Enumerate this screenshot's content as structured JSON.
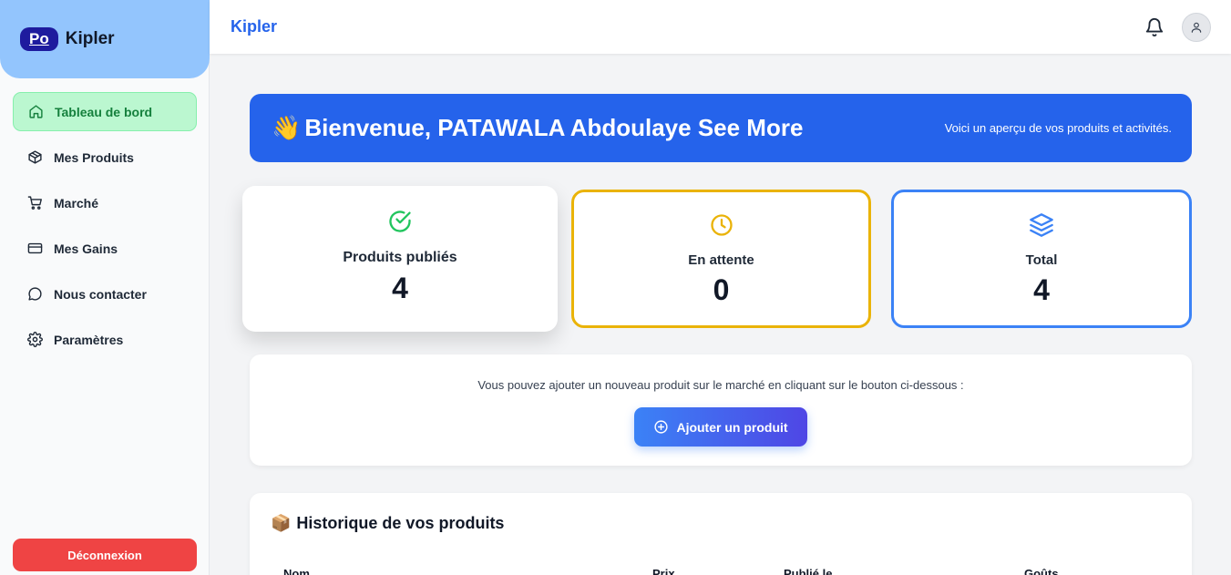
{
  "brand": {
    "badge": "Po",
    "name": "Kipler"
  },
  "sidebar": {
    "items": [
      {
        "label": "Tableau de bord",
        "icon": "home-icon",
        "active": true
      },
      {
        "label": "Mes Produits",
        "icon": "package-icon"
      },
      {
        "label": "Marché",
        "icon": "cart-icon"
      },
      {
        "label": "Mes Gains",
        "icon": "credit-card-icon"
      },
      {
        "label": "Nous contacter",
        "icon": "message-circle-icon"
      },
      {
        "label": "Paramètres",
        "icon": "gear-icon"
      }
    ],
    "logout_label": "Déconnexion"
  },
  "topbar": {
    "title": "Kipler"
  },
  "welcome": {
    "emoji": "👋",
    "title": "Bienvenue, PATAWALA Abdoulaye See More",
    "subtitle": "Voici un aperçu de vos produits et activités."
  },
  "stats": {
    "published": {
      "label": "Produits publiés",
      "value": "4",
      "color": "#22c55e"
    },
    "pending": {
      "label": "En attente",
      "value": "0",
      "color": "#eab308"
    },
    "total": {
      "label": "Total",
      "value": "4",
      "color": "#3b82f6"
    }
  },
  "add_product": {
    "text": "Vous pouvez ajouter un nouveau produit sur le marché en cliquant sur le bouton ci-dessous :",
    "button_label": "Ajouter un produit"
  },
  "history": {
    "emoji": "📦",
    "title": "Historique de vos produits",
    "columns": [
      "Nom",
      "Prix",
      "Publié le",
      "Goûts"
    ]
  },
  "colors": {
    "primary": "#2563eb",
    "danger": "#ef4444",
    "active_bg": "#bbf7d0"
  }
}
